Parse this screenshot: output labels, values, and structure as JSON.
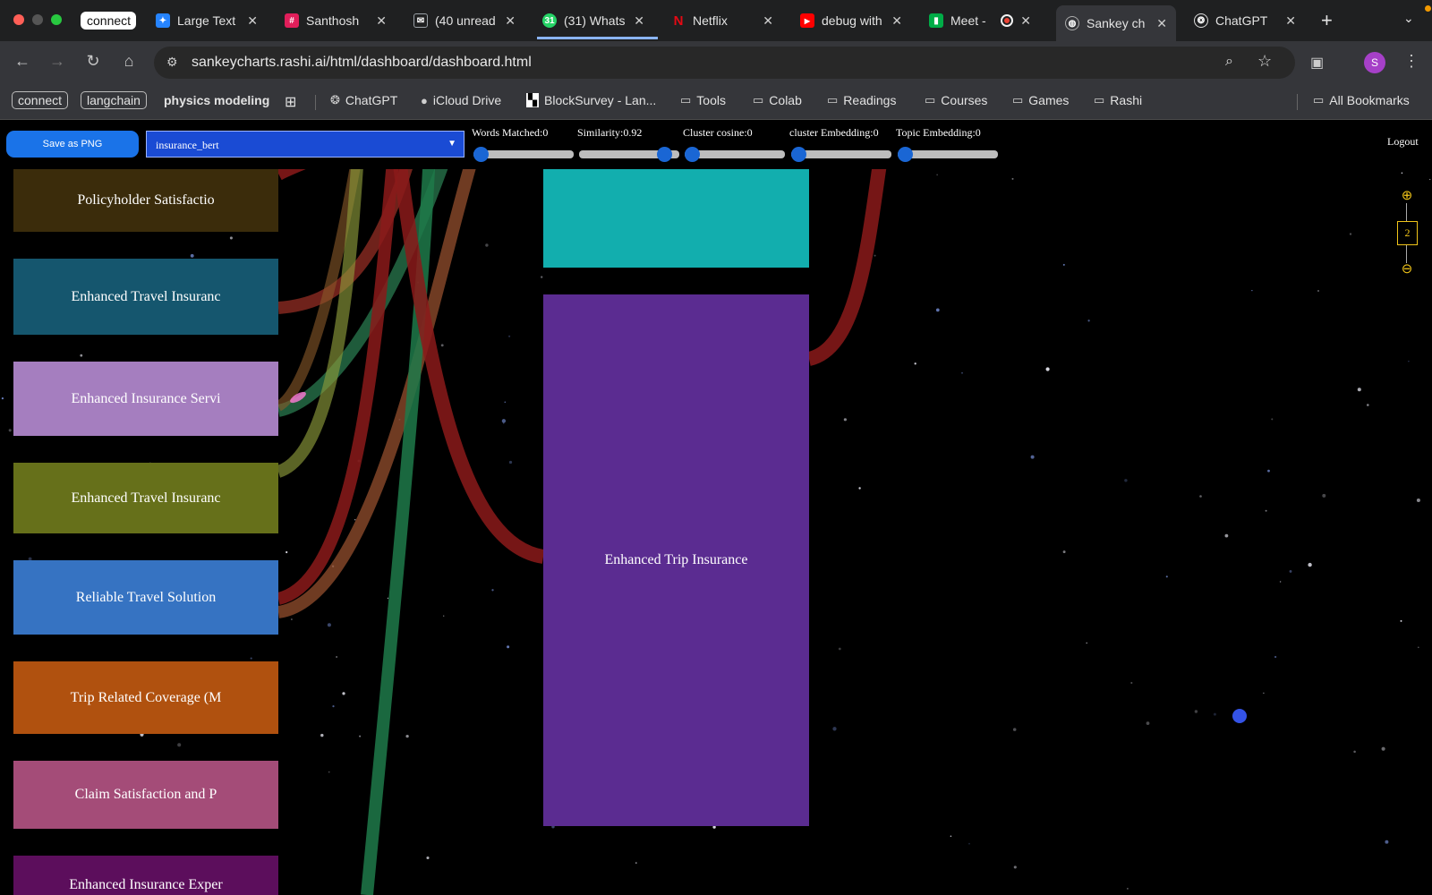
{
  "browser": {
    "tabs": [
      {
        "title": "connect",
        "favicon": "none",
        "pill": true
      },
      {
        "title": "Large Text",
        "favicon": "jira-icon",
        "color": "#2684ff"
      },
      {
        "title": "Santhosh",
        "favicon": "slack-icon",
        "color": "#e01e5a"
      },
      {
        "title": "(40 unread",
        "favicon": "mail-icon",
        "color": "#9aa0a6"
      },
      {
        "title": "(31) Whats",
        "favicon": "whatsapp-icon",
        "color": "#25d366"
      },
      {
        "title": "Netflix",
        "favicon": "netflix-icon",
        "color": "#e50914"
      },
      {
        "title": "debug with",
        "favicon": "youtube-icon",
        "color": "#ff0000"
      },
      {
        "title": "Meet -",
        "favicon": "meet-icon",
        "color": "#00ac47"
      },
      {
        "title": "Sankey ch",
        "favicon": "globe-icon",
        "color": "#9aa0a6",
        "active": true
      },
      {
        "title": "ChatGPT",
        "favicon": "openai-icon",
        "color": "#ffffff"
      }
    ],
    "url": "sankeycharts.rashi.ai/html/dashboard/dashboard.html",
    "profile_initial": "S",
    "bookmarks": [
      {
        "label": "connect",
        "boxed": true
      },
      {
        "label": "langchain",
        "boxed": true
      },
      {
        "label": "physics modeling",
        "boxed": false,
        "bold": true
      },
      {
        "label": "ChatGPT",
        "icon": "openai-icon"
      },
      {
        "label": "iCloud Drive",
        "icon": "apple-icon"
      },
      {
        "label": "BlockSurvey - Lan...",
        "icon": "blocksurvey-icon"
      },
      {
        "label": "Tools",
        "icon": "folder-icon"
      },
      {
        "label": "Colab",
        "icon": "folder-icon"
      },
      {
        "label": "Readings",
        "icon": "folder-icon"
      },
      {
        "label": "Courses",
        "icon": "folder-icon"
      },
      {
        "label": "Games",
        "icon": "folder-icon"
      },
      {
        "label": "Rashi",
        "icon": "folder-icon"
      }
    ],
    "all_bookmarks": "All Bookmarks"
  },
  "toolbar": {
    "save_label": "Save as PNG",
    "dataset": "insurance_bert",
    "logout": "Logout",
    "sliders": [
      {
        "label": "Words Matched:0",
        "value": 0.0
      },
      {
        "label": "Similarity:0.92",
        "value": 0.92
      },
      {
        "label": "Cluster cosine:0",
        "value": 0.0
      },
      {
        "label": "cluster Embedding:0",
        "value": 0.0
      },
      {
        "label": "Topic Embedding:0",
        "value": 0.0
      }
    ]
  },
  "sankey": {
    "left_nodes": [
      {
        "label": "Policyholder Satisfactio",
        "color": "#3b2c0b"
      },
      {
        "label": "Enhanced Travel Insuranc",
        "color": "#15566e"
      },
      {
        "label": "Enhanced Insurance Servi",
        "color": "#a57ebf"
      },
      {
        "label": "Enhanced Travel Insuranc",
        "color": "#66701a"
      },
      {
        "label": "Reliable Travel Solution",
        "color": "#3673c2"
      },
      {
        "label": "Trip Related Coverage (M",
        "color": "#b0510f"
      },
      {
        "label": "Claim Satisfaction and P",
        "color": "#a44c78"
      },
      {
        "label": "Enhanced Insurance Exper",
        "color": "#5c0e5c"
      }
    ],
    "right_nodes": [
      {
        "label": "",
        "color": "#12aeae"
      },
      {
        "label": "Enhanced Trip Insurance",
        "color": "#5b2c91"
      }
    ],
    "zoom_level": "2"
  }
}
